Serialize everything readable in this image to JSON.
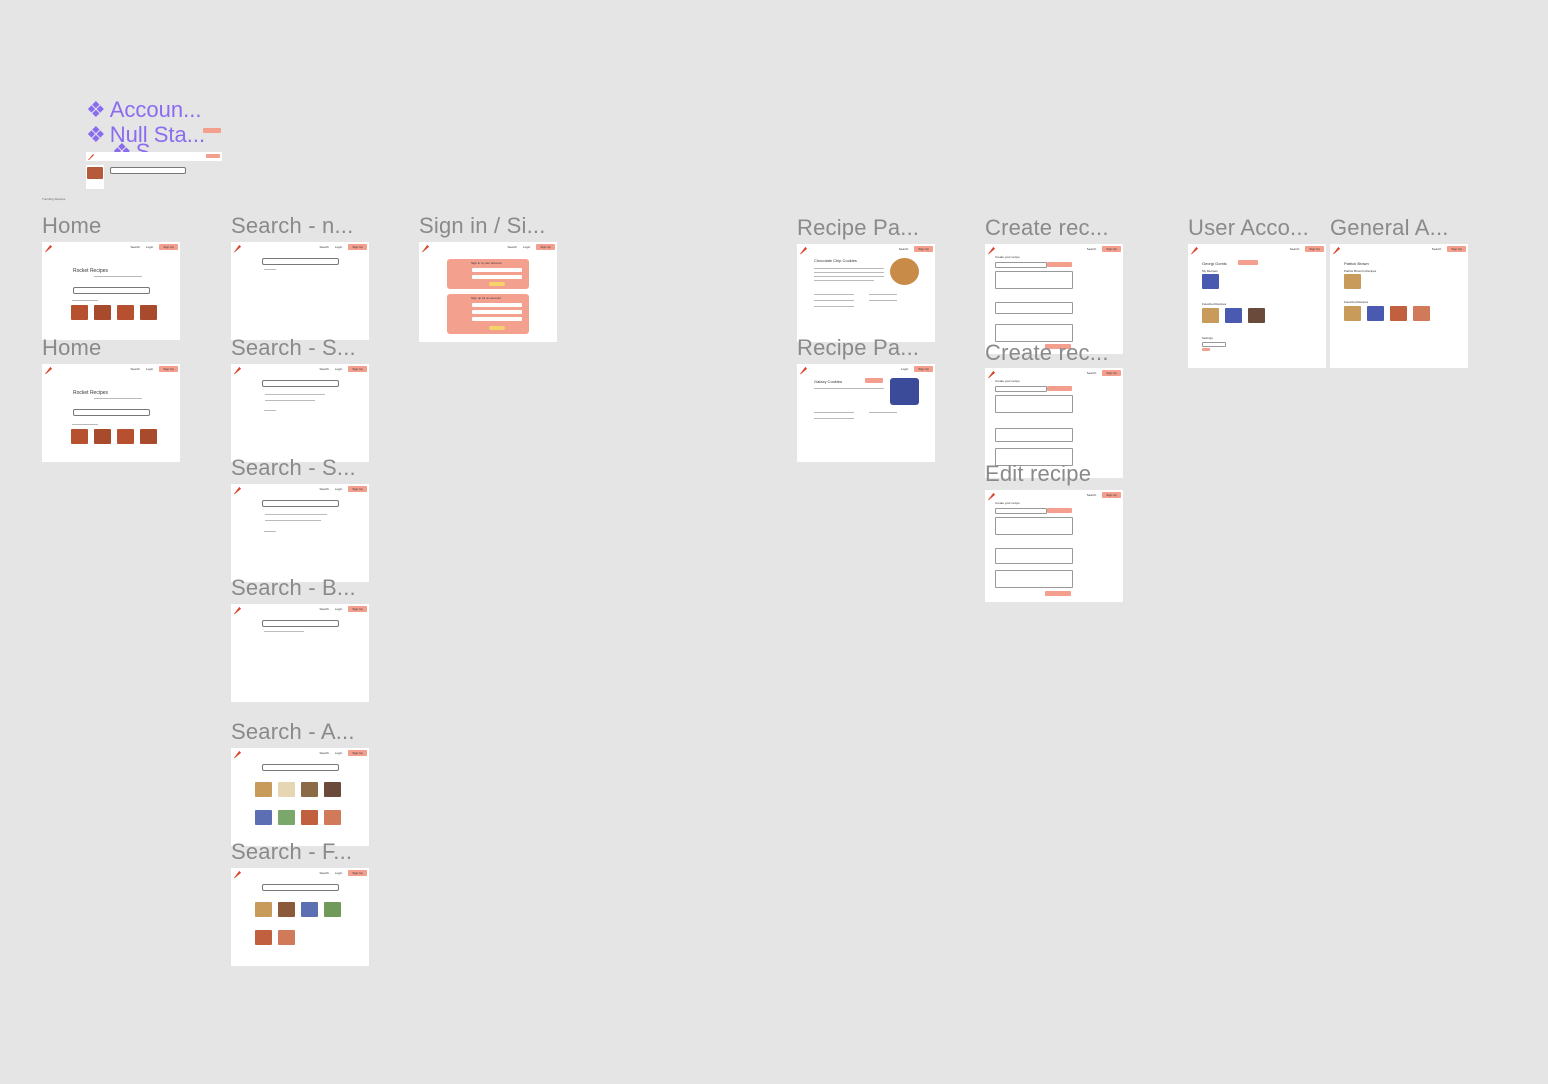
{
  "canvas": {
    "components": [
      {
        "label": "Accoun...",
        "icon": "component-icon"
      },
      {
        "label": "Null Sta...",
        "icon": "component-icon"
      },
      {
        "label": "S...",
        "icon": "component-icon"
      }
    ],
    "component_caption": "Trending Recipes"
  },
  "frames": {
    "home1": "Home",
    "home2": "Home",
    "search_n": "Search - n...",
    "search_s1": "Search - S...",
    "search_s2": "Search - S...",
    "search_b": "Search - B...",
    "search_a": "Search - A...",
    "search_f": "Search - F...",
    "signin": "Sign in / Si...",
    "recipe1": "Recipe Pa...",
    "recipe2": "Recipe Pa...",
    "create1": "Create rec...",
    "create2": "Create rec...",
    "edit": "Edit recipe",
    "user_account": "User Acco...",
    "general_account": "General A..."
  },
  "mini": {
    "home_title": "Rocket Recipes",
    "recipe1_title": "Chocolate Chip Cookies",
    "recipe2_title": "Galaxy Cookies",
    "create_heading": "Create your recipe",
    "user_name": "Georgi Gomis",
    "general_name": "Patrick Brown",
    "general_recipes": "Patrick Brown's Recipes",
    "my_recipes": "My Recipes",
    "favorited": "Favorited Recipes",
    "settings": "Settings",
    "signin_title": "Sign in to your account",
    "signup_title": "Sign up for an account",
    "search_placeholder": "Find recipes",
    "nav_search": "Search",
    "nav_login": "Login",
    "nav_signup": "Sign Up",
    "submit": "Submit"
  },
  "colors": {
    "canvas_bg": "#e5e5e5",
    "accent": "#f49e8e",
    "component": "#8b6cf0",
    "frame_label": "#8a8a8a",
    "button_yellow": "#f6d36a"
  }
}
